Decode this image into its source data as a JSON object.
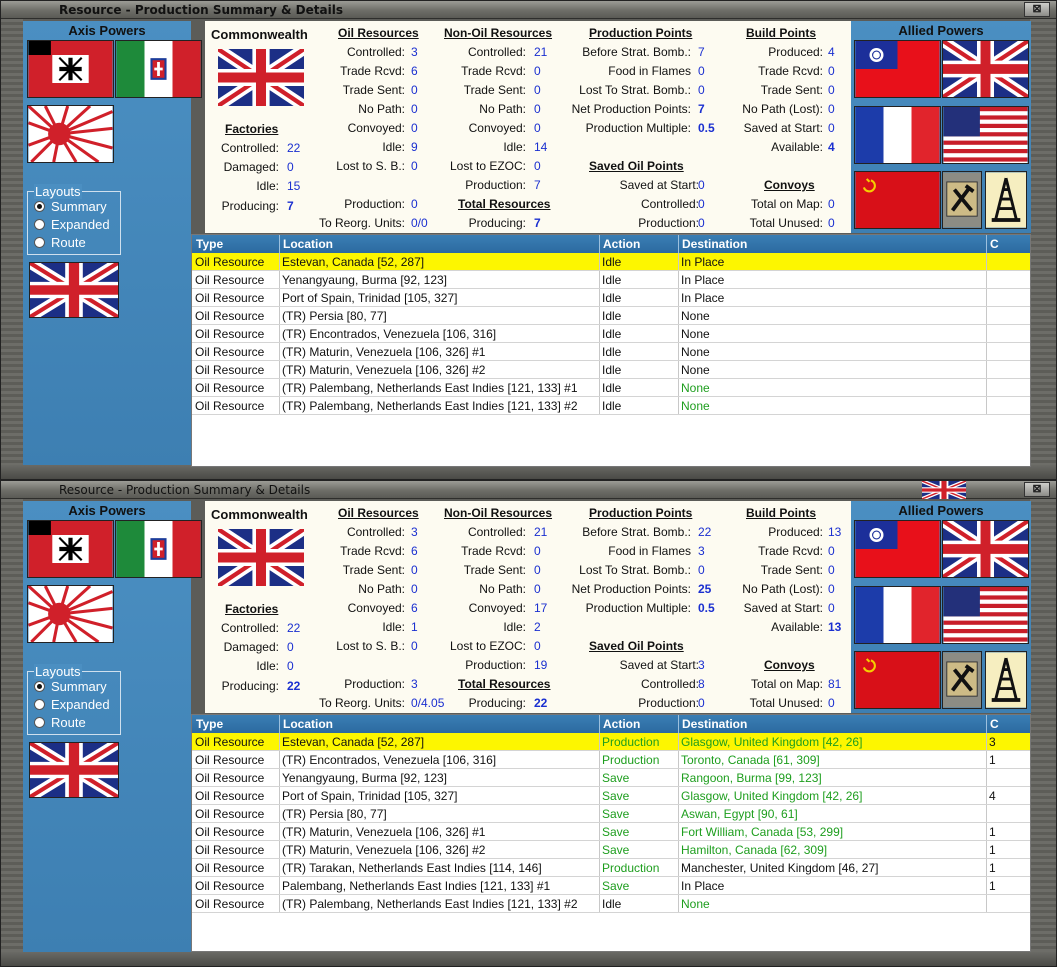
{
  "palette": {
    "link_blue": "#1a2fd0",
    "green": "#1e9e1e",
    "highlight": "#fdf600",
    "panel_blue": "#4b8fc2",
    "header_blue": "#2c6aa0"
  },
  "icons": [
    "close-icon",
    "radio-icon",
    "hammer-icon",
    "oil-derrick-icon",
    "flag-germany-icon",
    "flag-italy-icon",
    "flag-japan-icon",
    "flag-uk-icon",
    "flag-china-icon",
    "flag-france-icon",
    "flag-usa-icon",
    "flag-ussr-icon"
  ],
  "windows": [
    {
      "title": "Resource - Production Summary & Details",
      "axis_title": "Axis Powers",
      "allied_title": "Allied Powers",
      "layouts": {
        "legend": "Layouts",
        "options": [
          "Summary",
          "Expanded",
          "Route"
        ],
        "selected": "Summary"
      },
      "country": "Commonwealth",
      "factories": {
        "header": "Factories",
        "controlled_label": "Controlled:",
        "controlled": "22",
        "damaged_label": "Damaged:",
        "damaged": "0",
        "idle_label": "Idle:",
        "idle": "15",
        "producing_label": "Producing:",
        "producing": "7"
      },
      "oil": {
        "header": "Oil Resources",
        "controlled_label": "Controlled:",
        "controlled": "3",
        "trade_rcvd_label": "Trade Rcvd:",
        "trade_rcvd": "6",
        "trade_sent_label": "Trade Sent:",
        "trade_sent": "0",
        "no_path_label": "No Path:",
        "no_path": "0",
        "convoyed_label": "Convoyed:",
        "convoyed": "0",
        "idle_label": "Idle:",
        "idle": "9",
        "lost_sb_label": "Lost to S. B.:",
        "lost_sb": "0",
        "production_label": "Production:",
        "production": "0",
        "reorg_label": "To Reorg. Units:",
        "reorg": "0/0"
      },
      "nonoil": {
        "header": "Non-Oil Resources",
        "controlled_label": "Controlled:",
        "controlled": "21",
        "trade_rcvd_label": "Trade Rcvd:",
        "trade_rcvd": "0",
        "trade_sent_label": "Trade Sent:",
        "trade_sent": "0",
        "no_path_label": "No Path:",
        "no_path": "0",
        "convoyed_label": "Convoyed:",
        "convoyed": "0",
        "idle_label": "Idle:",
        "idle": "14",
        "lost_ezoc_label": "Lost to EZOC:",
        "lost_ezoc": "0",
        "production_label": "Production:",
        "production": "7"
      },
      "total_resources": {
        "header": "Total Resources",
        "producing_label": "Producing:",
        "producing": "7"
      },
      "production_points": {
        "header": "Production Points",
        "before_label": "Before Strat. Bomb.:",
        "before": "7",
        "food_label": "Food in Flames",
        "food": "0",
        "lost_label": "Lost To Strat. Bomb.:",
        "lost": "0",
        "net_label": "Net Production Points:",
        "net": "7",
        "multiple_label": "Production Multiple:",
        "multiple": "0.5"
      },
      "saved_oil": {
        "header": "Saved Oil Points",
        "saved_label": "Saved at Start:",
        "saved": "0",
        "controlled_label": "Controlled:",
        "controlled": "0",
        "production_label": "Production:",
        "production": "0"
      },
      "build_points": {
        "header": "Build Points",
        "produced_label": "Produced:",
        "produced": "4",
        "trade_rcvd_label": "Trade Rcvd:",
        "trade_rcvd": "0",
        "trade_sent_label": "Trade Sent:",
        "trade_sent": "0",
        "no_path_label": "No Path (Lost):",
        "no_path": "0",
        "saved_label": "Saved at Start:",
        "saved": "0",
        "available_label": "Available:",
        "available": "4"
      },
      "convoys": {
        "header": "Convoys",
        "total_map_label": "Total on Map:",
        "total_map": "0",
        "unused_label": "Total Unused:",
        "unused": "0"
      },
      "table": {
        "columns": [
          "Type",
          "Location",
          "Action",
          "Destination",
          "C"
        ],
        "rows": [
          {
            "type": "Oil Resource",
            "location": "Estevan, Canada [52, 287]",
            "action": "Idle",
            "destination": "In Place",
            "c": "",
            "selected": true,
            "action_green": false,
            "dest_green": false
          },
          {
            "type": "Oil Resource",
            "location": "Yenangyaung, Burma [92, 123]",
            "action": "Idle",
            "destination": "In Place",
            "c": "",
            "selected": false,
            "action_green": false,
            "dest_green": false
          },
          {
            "type": "Oil Resource",
            "location": "Port of Spain, Trinidad [105, 327]",
            "action": "Idle",
            "destination": "In Place",
            "c": "",
            "selected": false,
            "action_green": false,
            "dest_green": false
          },
          {
            "type": "Oil Resource",
            "location": "(TR) Persia [80, 77]",
            "action": "Idle",
            "destination": "None",
            "c": "",
            "selected": false,
            "action_green": false,
            "dest_green": false
          },
          {
            "type": "Oil Resource",
            "location": "(TR) Encontrados, Venezuela [106, 316]",
            "action": "Idle",
            "destination": "None",
            "c": "",
            "selected": false,
            "action_green": false,
            "dest_green": false
          },
          {
            "type": "Oil Resource",
            "location": "(TR) Maturin, Venezuela [106, 326] #1",
            "action": "Idle",
            "destination": "None",
            "c": "",
            "selected": false,
            "action_green": false,
            "dest_green": false
          },
          {
            "type": "Oil Resource",
            "location": "(TR) Maturin, Venezuela [106, 326] #2",
            "action": "Idle",
            "destination": "None",
            "c": "",
            "selected": false,
            "action_green": false,
            "dest_green": false
          },
          {
            "type": "Oil Resource",
            "location": "(TR) Palembang, Netherlands East Indies [121, 133] #1",
            "action": "Idle",
            "destination": "None",
            "c": "",
            "selected": false,
            "action_green": false,
            "dest_green": true
          },
          {
            "type": "Oil Resource",
            "location": "(TR) Palembang, Netherlands East Indies [121, 133] #2",
            "action": "Idle",
            "destination": "None",
            "c": "",
            "selected": false,
            "action_green": false,
            "dest_green": true
          }
        ]
      }
    },
    {
      "title": "Resource - Production Summary & Details",
      "axis_title": "Axis Powers",
      "allied_title": "Allied Powers",
      "layouts": {
        "legend": "Layouts",
        "options": [
          "Summary",
          "Expanded",
          "Route"
        ],
        "selected": "Summary"
      },
      "country": "Commonwealth",
      "factories": {
        "header": "Factories",
        "controlled_label": "Controlled:",
        "controlled": "22",
        "damaged_label": "Damaged:",
        "damaged": "0",
        "idle_label": "Idle:",
        "idle": "0",
        "producing_label": "Producing:",
        "producing": "22"
      },
      "oil": {
        "header": "Oil Resources",
        "controlled_label": "Controlled:",
        "controlled": "3",
        "trade_rcvd_label": "Trade Rcvd:",
        "trade_rcvd": "6",
        "trade_sent_label": "Trade Sent:",
        "trade_sent": "0",
        "no_path_label": "No Path:",
        "no_path": "0",
        "convoyed_label": "Convoyed:",
        "convoyed": "6",
        "idle_label": "Idle:",
        "idle": "1",
        "lost_sb_label": "Lost to S. B.:",
        "lost_sb": "0",
        "production_label": "Production:",
        "production": "3",
        "reorg_label": "To Reorg. Units:",
        "reorg": "0/4.05"
      },
      "nonoil": {
        "header": "Non-Oil Resources",
        "controlled_label": "Controlled:",
        "controlled": "21",
        "trade_rcvd_label": "Trade Rcvd:",
        "trade_rcvd": "0",
        "trade_sent_label": "Trade Sent:",
        "trade_sent": "0",
        "no_path_label": "No Path:",
        "no_path": "0",
        "convoyed_label": "Convoyed:",
        "convoyed": "17",
        "idle_label": "Idle:",
        "idle": "2",
        "lost_ezoc_label": "Lost to EZOC:",
        "lost_ezoc": "0",
        "production_label": "Production:",
        "production": "19"
      },
      "total_resources": {
        "header": "Total Resources",
        "producing_label": "Producing:",
        "producing": "22"
      },
      "production_points": {
        "header": "Production Points",
        "before_label": "Before Strat. Bomb.:",
        "before": "22",
        "food_label": "Food in Flames",
        "food": "3",
        "lost_label": "Lost To Strat. Bomb.:",
        "lost": "0",
        "net_label": "Net Production Points:",
        "net": "25",
        "multiple_label": "Production Multiple:",
        "multiple": "0.5"
      },
      "saved_oil": {
        "header": "Saved Oil Points",
        "saved_label": "Saved at Start:",
        "saved": "3",
        "controlled_label": "Controlled:",
        "controlled": "8",
        "production_label": "Production:",
        "production": "0"
      },
      "build_points": {
        "header": "Build Points",
        "produced_label": "Produced:",
        "produced": "13",
        "trade_rcvd_label": "Trade Rcvd:",
        "trade_rcvd": "0",
        "trade_sent_label": "Trade Sent:",
        "trade_sent": "0",
        "no_path_label": "No Path (Lost):",
        "no_path": "0",
        "saved_label": "Saved at Start:",
        "saved": "0",
        "available_label": "Available:",
        "available": "13"
      },
      "convoys": {
        "header": "Convoys",
        "total_map_label": "Total on Map:",
        "total_map": "81",
        "unused_label": "Total Unused:",
        "unused": "0"
      },
      "table": {
        "columns": [
          "Type",
          "Location",
          "Action",
          "Destination",
          "C"
        ],
        "rows": [
          {
            "type": "Oil Resource",
            "location": "Estevan, Canada [52, 287]",
            "action": "Production",
            "destination": "Glasgow, United Kingdom [42, 26]",
            "c": "3",
            "selected": true,
            "action_green": true,
            "dest_green": true
          },
          {
            "type": "Oil Resource",
            "location": "(TR) Encontrados, Venezuela [106, 316]",
            "action": "Production",
            "destination": "Toronto, Canada [61, 309]",
            "c": "1",
            "selected": false,
            "action_green": true,
            "dest_green": true
          },
          {
            "type": "Oil Resource",
            "location": "Yenangyaung, Burma [92, 123]",
            "action": "Save",
            "destination": "Rangoon, Burma [99, 123]",
            "c": "",
            "selected": false,
            "action_green": true,
            "dest_green": true
          },
          {
            "type": "Oil Resource",
            "location": "Port of Spain, Trinidad [105, 327]",
            "action": "Save",
            "destination": "Glasgow, United Kingdom [42, 26]",
            "c": "4",
            "selected": false,
            "action_green": true,
            "dest_green": true
          },
          {
            "type": "Oil Resource",
            "location": "(TR) Persia [80, 77]",
            "action": "Save",
            "destination": "Aswan, Egypt [90, 61]",
            "c": "",
            "selected": false,
            "action_green": true,
            "dest_green": true
          },
          {
            "type": "Oil Resource",
            "location": "(TR) Maturin, Venezuela [106, 326] #1",
            "action": "Save",
            "destination": "Fort William, Canada [53, 299]",
            "c": "1",
            "selected": false,
            "action_green": true,
            "dest_green": true
          },
          {
            "type": "Oil Resource",
            "location": "(TR) Maturin, Venezuela [106, 326] #2",
            "action": "Save",
            "destination": "Hamilton, Canada [62, 309]",
            "c": "1",
            "selected": false,
            "action_green": true,
            "dest_green": true
          },
          {
            "type": "Oil Resource",
            "location": "(TR) Tarakan, Netherlands East Indies [114, 146]",
            "action": "Production",
            "destination": "Manchester, United Kingdom [46, 27]",
            "c": "1",
            "selected": false,
            "action_green": true,
            "dest_green": false
          },
          {
            "type": "Oil Resource",
            "location": "Palembang, Netherlands East Indies [121, 133] #1",
            "action": "Save",
            "destination": "In Place",
            "c": "1",
            "selected": false,
            "action_green": true,
            "dest_green": false
          },
          {
            "type": "Oil Resource",
            "location": "(TR) Palembang, Netherlands East Indies [121, 133] #2",
            "action": "Idle",
            "destination": "None",
            "c": "",
            "selected": false,
            "action_green": false,
            "dest_green": true
          }
        ]
      }
    }
  ]
}
